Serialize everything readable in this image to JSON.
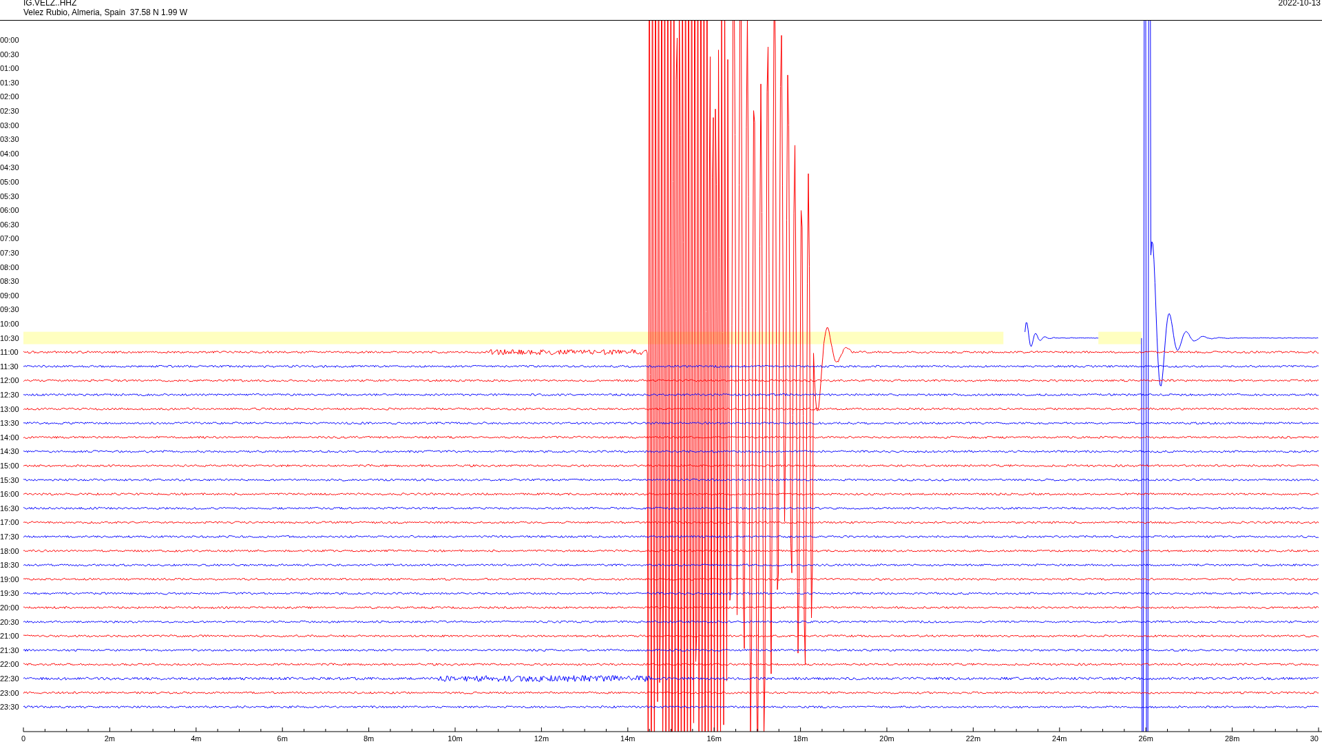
{
  "header": {
    "station": "IG.VELZ..HHZ",
    "location": "Velez Rubio, Almeria, Spain  37.58 N 1.99 W",
    "date": "2022-10-13"
  },
  "rows": [
    {
      "label": "00:00",
      "kind": "empty"
    },
    {
      "label": "00:30",
      "kind": "empty"
    },
    {
      "label": "01:00",
      "kind": "empty"
    },
    {
      "label": "01:30",
      "kind": "empty"
    },
    {
      "label": "02:00",
      "kind": "empty"
    },
    {
      "label": "02:30",
      "kind": "empty"
    },
    {
      "label": "03:00",
      "kind": "empty"
    },
    {
      "label": "03:30",
      "kind": "empty"
    },
    {
      "label": "04:00",
      "kind": "empty"
    },
    {
      "label": "04:30",
      "kind": "empty"
    },
    {
      "label": "05:00",
      "kind": "empty"
    },
    {
      "label": "05:30",
      "kind": "empty"
    },
    {
      "label": "06:00",
      "kind": "empty"
    },
    {
      "label": "06:30",
      "kind": "empty"
    },
    {
      "label": "07:00",
      "kind": "empty"
    },
    {
      "label": "07:30",
      "kind": "empty"
    },
    {
      "label": "08:00",
      "kind": "empty"
    },
    {
      "label": "08:30",
      "kind": "empty"
    },
    {
      "label": "09:00",
      "kind": "empty"
    },
    {
      "label": "09:30",
      "kind": "empty"
    },
    {
      "label": "10:00",
      "kind": "empty"
    },
    {
      "label": "10:30",
      "kind": "current",
      "color": "#0000ff"
    },
    {
      "label": "11:00",
      "kind": "quake",
      "color": "#ff0000"
    },
    {
      "label": "11:30",
      "kind": "trace",
      "color": "#0000ff"
    },
    {
      "label": "12:00",
      "kind": "trace",
      "color": "#ff0000"
    },
    {
      "label": "12:30",
      "kind": "trace",
      "color": "#0000ff"
    },
    {
      "label": "13:00",
      "kind": "trace",
      "color": "#ff0000"
    },
    {
      "label": "13:30",
      "kind": "trace",
      "color": "#0000ff"
    },
    {
      "label": "14:00",
      "kind": "trace",
      "color": "#ff0000"
    },
    {
      "label": "14:30",
      "kind": "trace",
      "color": "#0000ff"
    },
    {
      "label": "15:00",
      "kind": "trace",
      "color": "#ff0000"
    },
    {
      "label": "15:30",
      "kind": "trace",
      "color": "#0000ff"
    },
    {
      "label": "16:00",
      "kind": "trace",
      "color": "#ff0000"
    },
    {
      "label": "16:30",
      "kind": "trace",
      "color": "#0000ff"
    },
    {
      "label": "17:00",
      "kind": "trace",
      "color": "#ff0000"
    },
    {
      "label": "17:30",
      "kind": "trace",
      "color": "#0000ff"
    },
    {
      "label": "18:00",
      "kind": "trace",
      "color": "#ff0000"
    },
    {
      "label": "18:30",
      "kind": "trace",
      "color": "#0000ff"
    },
    {
      "label": "19:00",
      "kind": "trace",
      "color": "#ff0000"
    },
    {
      "label": "19:30",
      "kind": "trace",
      "color": "#0000ff"
    },
    {
      "label": "20:00",
      "kind": "trace",
      "color": "#ff0000"
    },
    {
      "label": "20:30",
      "kind": "trace",
      "color": "#0000ff"
    },
    {
      "label": "21:00",
      "kind": "trace",
      "color": "#ff0000"
    },
    {
      "label": "21:30",
      "kind": "trace",
      "color": "#0000ff"
    },
    {
      "label": "22:00",
      "kind": "trace",
      "color": "#ff0000"
    },
    {
      "label": "22:30",
      "kind": "noisy",
      "color": "#0000ff"
    },
    {
      "label": "23:00",
      "kind": "trace",
      "color": "#ff0000"
    },
    {
      "label": "23:30",
      "kind": "trace",
      "color": "#0000ff"
    }
  ],
  "x_axis": {
    "ticks": [
      "0",
      "2m",
      "4m",
      "6m",
      "8m",
      "10m",
      "12m",
      "14m",
      "16m",
      "18m",
      "20m",
      "22m",
      "24m",
      "26m",
      "28m",
      "30"
    ]
  }
}
